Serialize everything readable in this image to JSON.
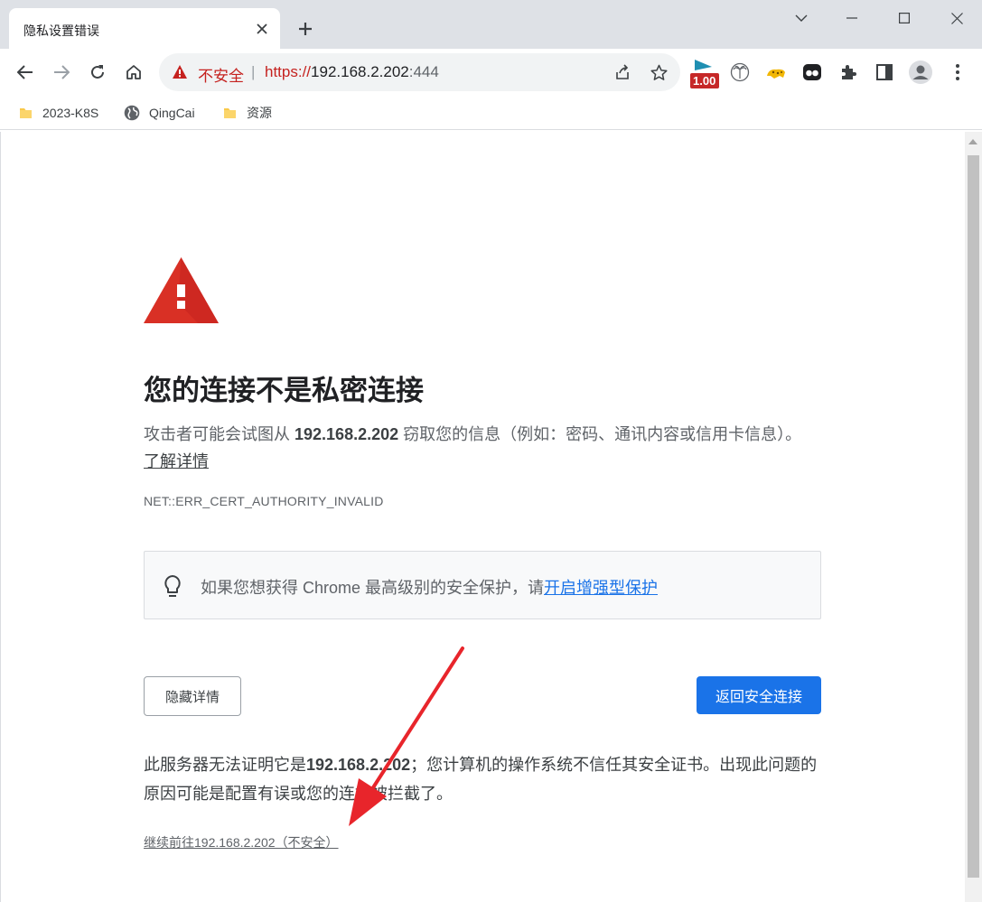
{
  "tab": {
    "title": "隐私设置错误"
  },
  "omnibox": {
    "security_label": "不安全",
    "separator": "|",
    "url_scheme": "https://",
    "url_host": "192.168.2.202",
    "url_port": ":444"
  },
  "extensions": {
    "badge": "1.00"
  },
  "bookmarks": [
    {
      "label": "2023-K8S",
      "icon": "folder-icon"
    },
    {
      "label": "QingCai",
      "icon": "globe-icon"
    },
    {
      "label": "资源",
      "icon": "folder-icon"
    }
  ],
  "page": {
    "heading": "您的连接不是私密连接",
    "para_prefix": "攻击者可能会试图从 ",
    "para_host": "192.168.2.202",
    "para_suffix": " 窃取您的信息（例如：密码、通讯内容或信用卡信息）。",
    "learn_more": "了解详情",
    "error_code": "NET::ERR_CERT_AUTHORITY_INVALID",
    "promo_text": "如果您想获得 Chrome 最高级别的安全保护，请",
    "promo_link": "开启增强型保护",
    "hide_details": "隐藏详情",
    "back_to_safety": "返回安全连接",
    "details_prefix": "此服务器无法证明它是",
    "details_host": "192.168.2.202",
    "details_suffix": "；您计算机的操作系统不信任其安全证书。出现此问题的原因可能是配置有误或您的连接被拦截了。",
    "proceed_link": "继续前往192.168.2.202（不安全）"
  },
  "colors": {
    "danger": "#d93025",
    "link_blue": "#1a73e8",
    "annotation_red": "#e8252b"
  }
}
